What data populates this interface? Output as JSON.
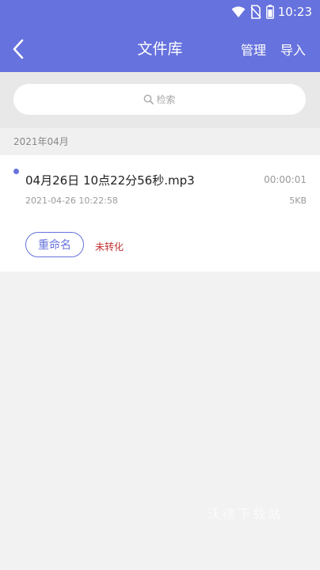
{
  "status_bar": {
    "time": "10:23",
    "icons": [
      "wifi-icon",
      "no-sim-icon",
      "battery-icon"
    ]
  },
  "header": {
    "title": "文件库",
    "back_icon": "chevron-left-icon",
    "manage_label": "管理",
    "import_label": "导入",
    "bg_color": "#6672dd"
  },
  "search": {
    "placeholder": "检索",
    "icon": "search-icon"
  },
  "groups": [
    {
      "month": "2021年04月",
      "files": [
        {
          "name": "04月26日 10点22分56秒.mp3",
          "duration": "00:00:01",
          "date": "2021-04-26 10:22:58",
          "size": "5KB",
          "rename_label": "重命名",
          "status": "未转化",
          "status_color": "#c03030"
        }
      ]
    }
  ],
  "watermark": "沃德下载站"
}
